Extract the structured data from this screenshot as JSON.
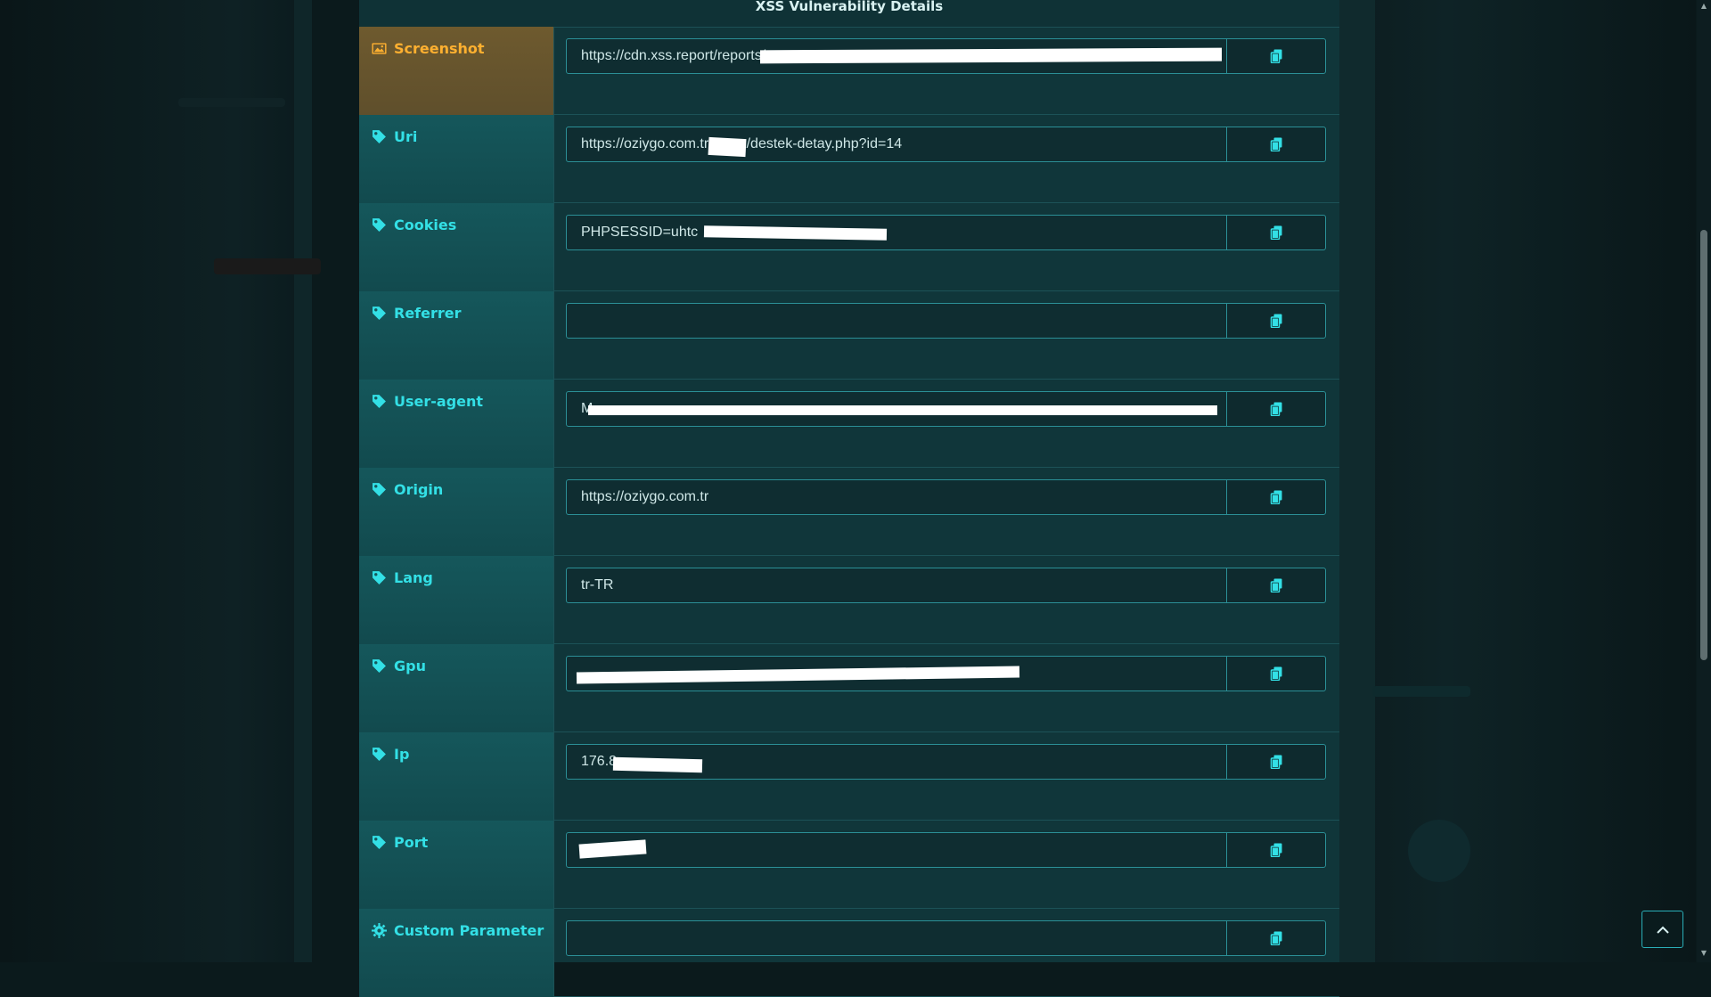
{
  "card": {
    "title": "XSS Vulnerability Details"
  },
  "rows": [
    {
      "label": "Screenshot",
      "value": "https://cdn.xss.report/reports/",
      "icon": "image-icon",
      "highlight": true
    },
    {
      "label": "Uri",
      "value": "https://oziygo.com.tr/",
      "value_suffix": "/destek-detay.php?id=14",
      "icon": "tag-icon"
    },
    {
      "label": "Cookies",
      "value": "PHPSESSID=uhtc",
      "icon": "tag-icon"
    },
    {
      "label": "Referrer",
      "value": "",
      "icon": "tag-icon"
    },
    {
      "label": "User-agent",
      "value": "M",
      "icon": "tag-icon"
    },
    {
      "label": "Origin",
      "value": "https://oziygo.com.tr",
      "icon": "tag-icon"
    },
    {
      "label": "Lang",
      "value": "tr-TR",
      "icon": "tag-icon"
    },
    {
      "label": "Gpu",
      "value": "",
      "icon": "tag-icon"
    },
    {
      "label": "Ip",
      "value": "176.8",
      "icon": "tag-icon"
    },
    {
      "label": "Port",
      "value": "",
      "icon": "tag-icon"
    },
    {
      "label": "Custom Parameter",
      "value": "",
      "icon": "gear-icon"
    }
  ],
  "copy_icon": "copy-icon",
  "back_to_top_icon": "chevron-up-icon",
  "colors": {
    "accent": "#33e0e6",
    "highlight": "#ffb030",
    "card": "#10363a"
  }
}
